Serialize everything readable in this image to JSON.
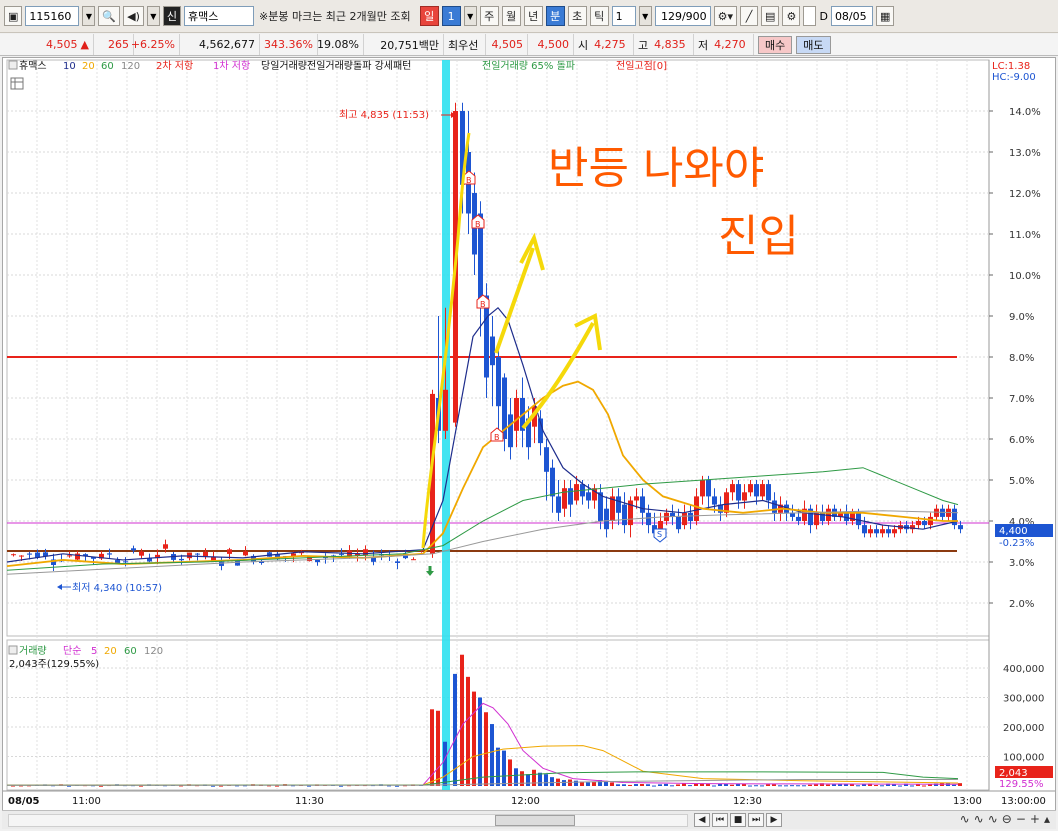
{
  "toolbar": {
    "stock_code": "115160",
    "market_tag": "신",
    "stock_name": "휴맥스",
    "notice": "※분봉 마크는 최근 2개월만 조회",
    "periods": [
      "일",
      "1",
      "주",
      "월",
      "년",
      "분",
      "초",
      "틱"
    ],
    "active_period": "분",
    "interval": "1",
    "data_count": "129/900",
    "date_checkbox_label": "D",
    "date": "08/05"
  },
  "quote": {
    "price": "4,505",
    "change_arrow": "▲",
    "change": "265",
    "change_pct": "+6.25%",
    "volume": "4,562,677",
    "volume_ratio": "343.36%",
    "turnover": "19.08%",
    "amount": "20,751백만",
    "best_ask_label": "최우선",
    "best_ask": "4,505",
    "best_bid": "4,500",
    "open_label": "시",
    "open": "4,275",
    "high_label": "고",
    "high": "4,835",
    "low_label": "저",
    "low": "4,270",
    "buy_button": "매수",
    "sell_button": "매도"
  },
  "price_panel": {
    "legend": {
      "name": "휴맥스",
      "ma": [
        "10",
        "20",
        "60",
        "120"
      ],
      "resistance2": "2차 저항",
      "resistance1": "1차 저항",
      "volume_pattern": "당일거래량전일거래량돌파 강세패턴",
      "prev_volume": "전일거래량 65% 돌파",
      "prev_high": "전일고점[0]"
    },
    "lc": "LC:1.38",
    "hc": "HC:-9.00",
    "y_ticks": [
      "14.0%",
      "13.0%",
      "12.0%",
      "11.0%",
      "10.0%",
      "9.0%",
      "8.0%",
      "7.0%",
      "6.0%",
      "5.0%",
      "4.0%",
      "3.0%",
      "2.0%"
    ],
    "current_value": "4,400",
    "current_pct": "-0.23%",
    "high_marker": "최고 4,835 (11:53)",
    "low_marker": "최저 4,340 (10:57)",
    "annotation_line1": "반등 나와야",
    "annotation_line2": "진입",
    "colors": {
      "up": "#e8231a",
      "down": "#1d55d2",
      "ma10": "#1e2d8c",
      "ma20": "#f0a800",
      "ma60": "#2e9a45",
      "ma120": "#999999",
      "highlight": "#2fe1f0",
      "resistance_red": "#e8231a",
      "support_brown": "#8b3a10",
      "magenta_line": "#d12fd1",
      "annotation": "#ff5a00",
      "arrow_yellow": "#f5d90a"
    }
  },
  "volume_panel": {
    "legend": {
      "name": "거래량",
      "ma_label": "단순",
      "ma": [
        "5",
        "20",
        "60",
        "120"
      ]
    },
    "current": "2,043주(129.55%)",
    "y_ticks": [
      "400,000",
      "300,000",
      "200,000",
      "100,000"
    ],
    "current_value": "2,043",
    "current_pct": "129.55%"
  },
  "time_axis": {
    "date_label": "08/05",
    "labels": [
      "11:00",
      "11:30",
      "12:00",
      "12:30",
      "13:00"
    ],
    "right_label": "13:00:00"
  }
}
